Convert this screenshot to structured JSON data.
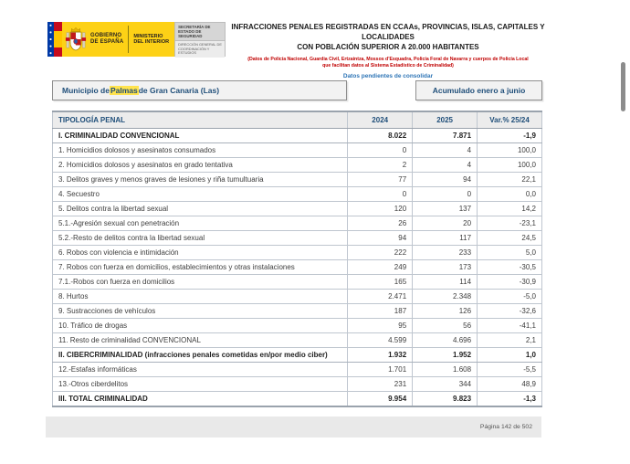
{
  "logo": {
    "gobierno_line1": "GOBIERNO",
    "gobierno_line2": "DE ESPAÑA",
    "ministerio_line1": "MINISTERIO",
    "ministerio_line2": "DEL INTERIOR",
    "secretaria": "SECRETARÍA DE ESTADO DE SEGURIDAD",
    "direccion": "DIRECCIÓN GENERAL DE COORDINACIÓN Y ESTUDIOS",
    "icons": [
      "eu-stars-strip-icon",
      "spain-flag-icon",
      "spain-coat-of-arms-icon"
    ]
  },
  "header": {
    "title_line1": "INFRACCIONES PENALES REGISTRADAS EN CCAAs, PROVINCIAS, ISLAS, CAPITALES Y LOCALIDADES",
    "title_line2": "CON POBLACIÓN SUPERIOR A 20.000 HABITANTES",
    "source_note_line1": "(Datos de Policía Nacional, Guardia Civil, Ertzaintza, Mossos d'Esquadra, Policía Foral de Navarra y cuerpos de Policía Local",
    "source_note_line2": "que facilitan datos al Sistema Estadístico de Criminalidad)",
    "status_note": "Datos pendientes de consolidar"
  },
  "filters": {
    "municipality_prefix": "Municipio de ",
    "municipality_highlight": "Palmas",
    "municipality_suffix": " de Gran Canaria (Las)",
    "period": "Acumulado enero a junio"
  },
  "table": {
    "columns": [
      "TIPOLOGÍA PENAL",
      "2024",
      "2025",
      "Var.% 25/24"
    ],
    "rows": [
      {
        "label": "I. CRIMINALIDAD CONVENCIONAL",
        "y2024": "8.022",
        "y2025": "7.871",
        "var": "-1,9",
        "bold": true
      },
      {
        "label": "1. Homicidios dolosos y asesinatos consumados",
        "y2024": "0",
        "y2025": "4",
        "var": "100,0",
        "bold": false
      },
      {
        "label": "2. Homicidios dolosos y asesinatos en grado tentativa",
        "y2024": "2",
        "y2025": "4",
        "var": "100,0",
        "bold": false
      },
      {
        "label": "3. Delitos graves y menos graves de lesiones y riña tumultuaria",
        "y2024": "77",
        "y2025": "94",
        "var": "22,1",
        "bold": false
      },
      {
        "label": "4. Secuestro",
        "y2024": "0",
        "y2025": "0",
        "var": "0,0",
        "bold": false
      },
      {
        "label": "5. Delitos contra la libertad sexual",
        "y2024": "120",
        "y2025": "137",
        "var": "14,2",
        "bold": false
      },
      {
        "label": "5.1.-Agresión sexual con penetración",
        "y2024": "26",
        "y2025": "20",
        "var": "-23,1",
        "bold": false
      },
      {
        "label": "5.2.-Resto de delitos contra la libertad sexual",
        "y2024": "94",
        "y2025": "117",
        "var": "24,5",
        "bold": false
      },
      {
        "label": "6. Robos con violencia e intimidación",
        "y2024": "222",
        "y2025": "233",
        "var": "5,0",
        "bold": false
      },
      {
        "label": "7. Robos con fuerza en domicilios, establecimientos y otras instalaciones",
        "y2024": "249",
        "y2025": "173",
        "var": "-30,5",
        "bold": false
      },
      {
        "label": "7.1.-Robos con fuerza en domicilios",
        "y2024": "165",
        "y2025": "114",
        "var": "-30,9",
        "bold": false
      },
      {
        "label": "8. Hurtos",
        "y2024": "2.471",
        "y2025": "2.348",
        "var": "-5,0",
        "bold": false
      },
      {
        "label": "9. Sustracciones de vehículos",
        "y2024": "187",
        "y2025": "126",
        "var": "-32,6",
        "bold": false
      },
      {
        "label": "10. Tráfico de drogas",
        "y2024": "95",
        "y2025": "56",
        "var": "-41,1",
        "bold": false
      },
      {
        "label": "11. Resto de criminalidad CONVENCIONAL",
        "y2024": "4.599",
        "y2025": "4.696",
        "var": "2,1",
        "bold": false
      },
      {
        "label": "II. CIBERCRIMINALIDAD (infracciones penales cometidas en/por medio ciber)",
        "y2024": "1.932",
        "y2025": "1.952",
        "var": "1,0",
        "bold": true
      },
      {
        "label": "12.-Estafas informáticas",
        "y2024": "1.701",
        "y2025": "1.608",
        "var": "-5,5",
        "bold": false
      },
      {
        "label": "13.-Otros ciberdelitos",
        "y2024": "231",
        "y2025": "344",
        "var": "48,9",
        "bold": false
      },
      {
        "label": "III. TOTAL CRIMINALIDAD",
        "y2024": "9.954",
        "y2025": "9.823",
        "var": "-1,3",
        "bold": true
      }
    ]
  },
  "footer": {
    "page_indicator": "Página 142 de 502"
  },
  "colors": {
    "navy_text": "#1f4e79",
    "source_note_red": "#c00000",
    "status_note_blue": "#2e75b6",
    "highlight_yellow": "#ffe34d",
    "logo_yellow": "#fdd116",
    "flag_red": "#c60b1e",
    "flag_yellow": "#ffc400",
    "eu_blue": "#0039a6",
    "header_row_bg": "#ececec",
    "footer_bg": "#e9e9e9"
  }
}
